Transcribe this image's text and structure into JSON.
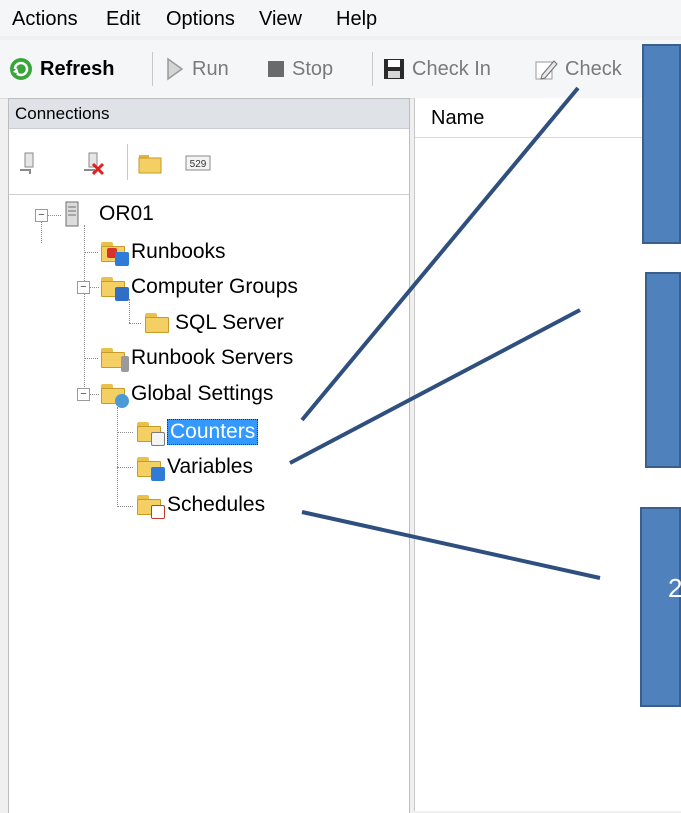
{
  "menu": [
    "Actions",
    "Edit",
    "Options",
    "View",
    "Help"
  ],
  "toolbar": {
    "refresh": "Refresh",
    "run": "Run",
    "stop": "Stop",
    "check_in": "Check In",
    "check_out": "Check"
  },
  "connections": {
    "title": "Connections"
  },
  "tree": {
    "root": "OR01",
    "runbooks": "Runbooks",
    "computer_groups": "Computer Groups",
    "sql_server": "SQL Server",
    "runbook_servers": "Runbook Servers",
    "global_settings": "Global Settings",
    "counters": "Counters",
    "variables": "Variables",
    "schedules": "Schedules"
  },
  "content": {
    "column_name": "Name"
  },
  "callouts": {
    "third_partial_text": "2"
  },
  "colors": {
    "callout_fill": "#4f81bd",
    "selection": "#3399ff",
    "connector_line": "#2f4f7f"
  }
}
